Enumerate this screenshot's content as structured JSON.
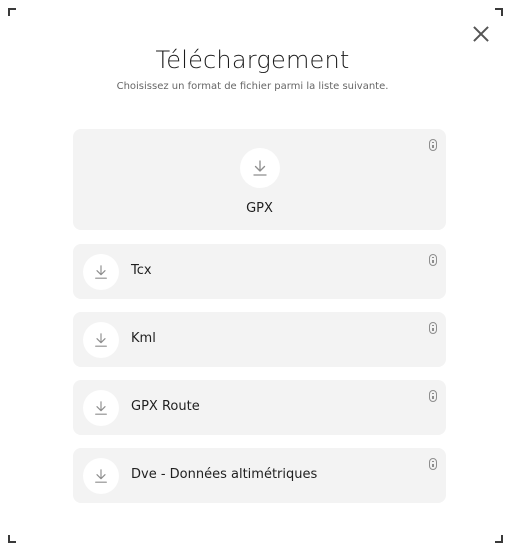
{
  "dialog": {
    "title": "Téléchargement",
    "subtitle": "Choisissez un format de fichier parmi la liste suivante."
  },
  "formats": [
    {
      "label": "GPX"
    },
    {
      "label": "Tcx"
    },
    {
      "label": "Kml"
    },
    {
      "label": "GPX Route"
    },
    {
      "label": "Dve - Données altimétriques"
    }
  ],
  "icons": {
    "download": "download-icon",
    "info": "info-icon",
    "close": "close-icon"
  },
  "colors": {
    "card_bg": "#f3f3f3",
    "icon_gray": "#8d8d8d",
    "text": "#1f1f1f"
  }
}
